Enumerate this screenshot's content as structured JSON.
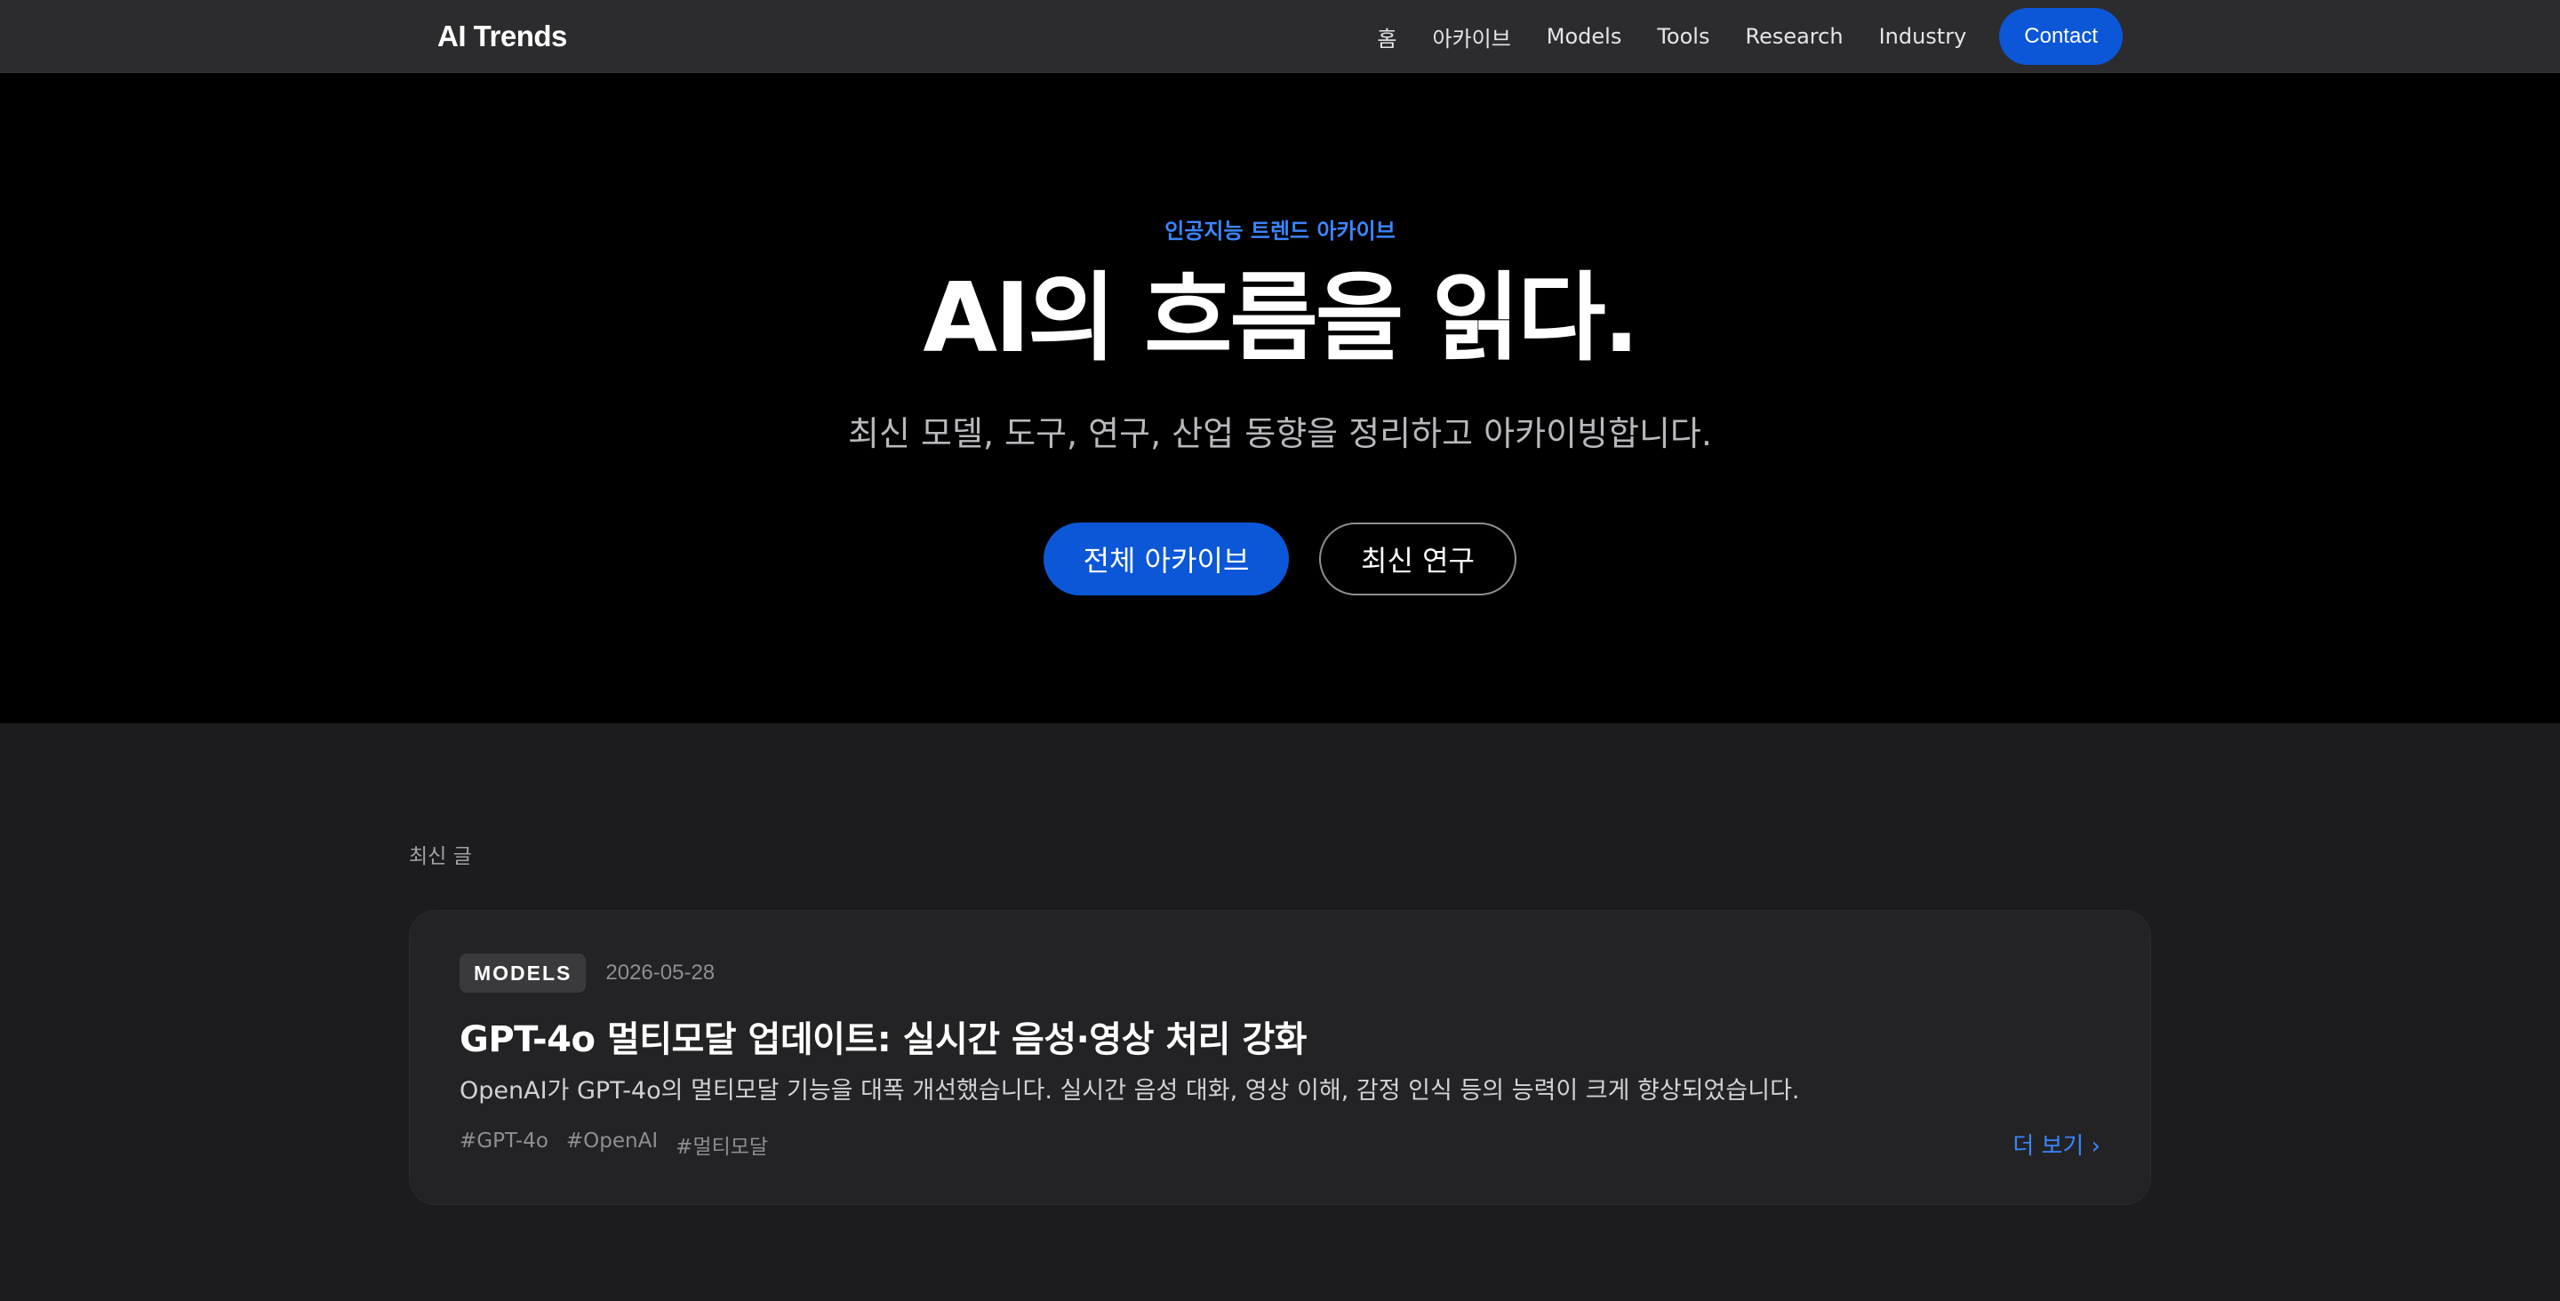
{
  "nav": {
    "brand": "AI Trends",
    "links": [
      "홈",
      "아카이브",
      "Models",
      "Tools",
      "Research",
      "Industry"
    ],
    "contact": "Contact"
  },
  "hero": {
    "kicker": "인공지능 트렌드 아카이브",
    "title": "AI의 흐름을 읽다.",
    "subtitle": "최신 모델, 도구, 연구, 산업 동향을 정리하고 아카이빙합니다.",
    "primary_button": "전체 아카이브",
    "secondary_button": "최신 연구"
  },
  "latest": {
    "label": "최신 글",
    "post": {
      "category": "MODELS",
      "date": "2026-05-28",
      "title": "GPT-4o 멀티모달 업데이트: 실시간 음성·영상 처리 강화",
      "excerpt": "OpenAI가 GPT-4o의 멀티모달 기능을 대폭 개선했습니다. 실시간 음성 대화, 영상 이해, 감정 인식 등의 능력이 크게 향상되었습니다.",
      "tags": [
        "#GPT-4o",
        "#OpenAI",
        "#멀티모달"
      ],
      "more": "더 보기 ›"
    }
  },
  "colors": {
    "accent": "#0b57d8",
    "link": "#3a86ff",
    "hero_bg": "#000000",
    "nav_bg": "#2c2c2e",
    "page_bg": "#1c1c1e",
    "card_bg": "#232325"
  }
}
